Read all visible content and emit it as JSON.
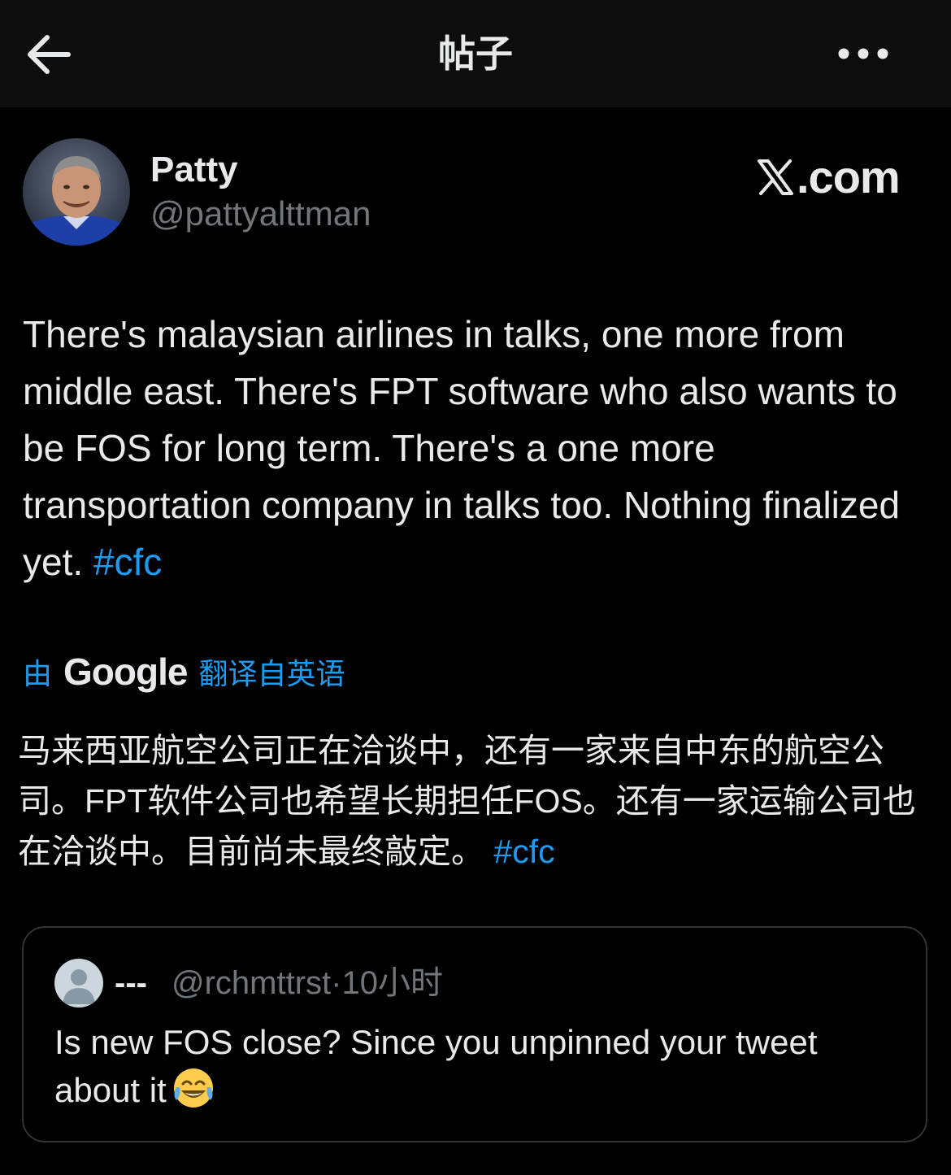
{
  "header": {
    "title": "帖子",
    "back_icon": "arrow-left-icon",
    "more_icon": "more-horizontal-icon"
  },
  "post": {
    "author_name": "Patty",
    "author_handle": "@pattyalttman",
    "brand": "X.com",
    "brand_suffix": ".com",
    "text": "There's malaysian airlines in talks, one more from middle east. There's FPT software who also wants to be FOS for long term. There's a one more transportation company in talks too. Nothing finalized yet.",
    "hashtag": "#cfc"
  },
  "translation": {
    "prefix": "由",
    "provider": "Google",
    "suffix": "翻译自英语",
    "text": "马来西亚航空公司正在洽谈中，还有一家来自中东的航空公司。FPT软件公司也希望长期担任FOS。还有一家运输公司也在洽谈中。目前尚未最终敲定。",
    "hashtag": "#cfc"
  },
  "quoted_post": {
    "author_name": "---",
    "author_handle": "@rchmttrst",
    "separator": "·",
    "time": "10小时",
    "text": "Is new FOS close? Since you unpinned your tweet about it",
    "emoji": "face-with-tears-of-joy"
  },
  "colors": {
    "background": "#000000",
    "header_bg": "#0d0d0d",
    "text_primary": "#e7e9ea",
    "text_secondary": "#71767b",
    "link": "#1d9bf0",
    "border": "#2f3336"
  }
}
